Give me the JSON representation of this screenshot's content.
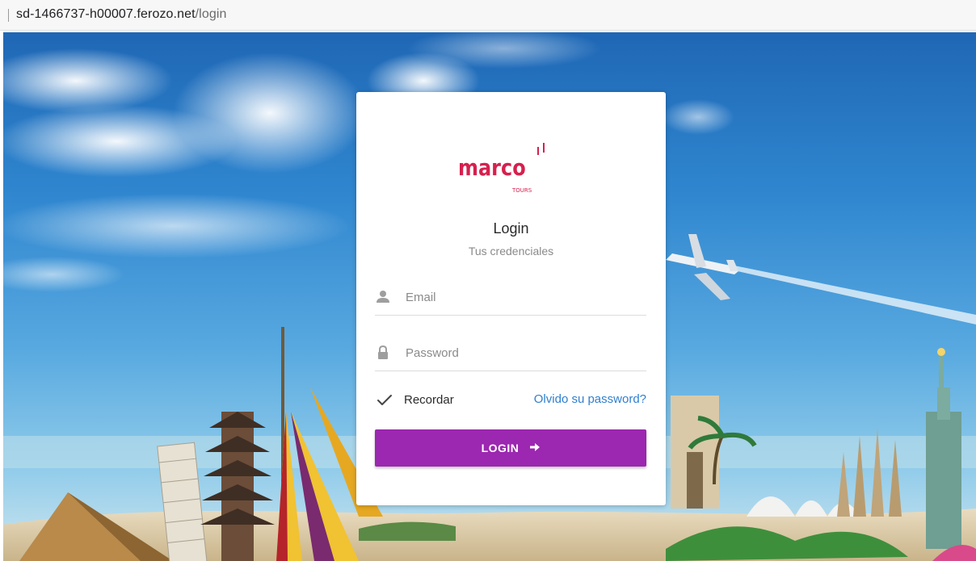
{
  "browser": {
    "url_host": "sd-1466737-h00007.ferozo.net",
    "url_path": "/login"
  },
  "login": {
    "logo": {
      "brand": "marco",
      "sub": "TOURS"
    },
    "title": "Login",
    "subtitle": "Tus credenciales",
    "email_placeholder": "Email",
    "password_placeholder": "Password",
    "remember_label": "Recordar",
    "remember_checked": true,
    "forgot_link": "Olvido su password?",
    "submit_label": "LOGIN"
  },
  "colors": {
    "accent": "#9c27b0",
    "link": "#2f7fd0",
    "logo": "#d6204e"
  },
  "icons": {
    "email_field": "user-icon",
    "password_field": "lock-icon",
    "remember": "checkmark-icon",
    "submit": "arrow-right-icon"
  }
}
